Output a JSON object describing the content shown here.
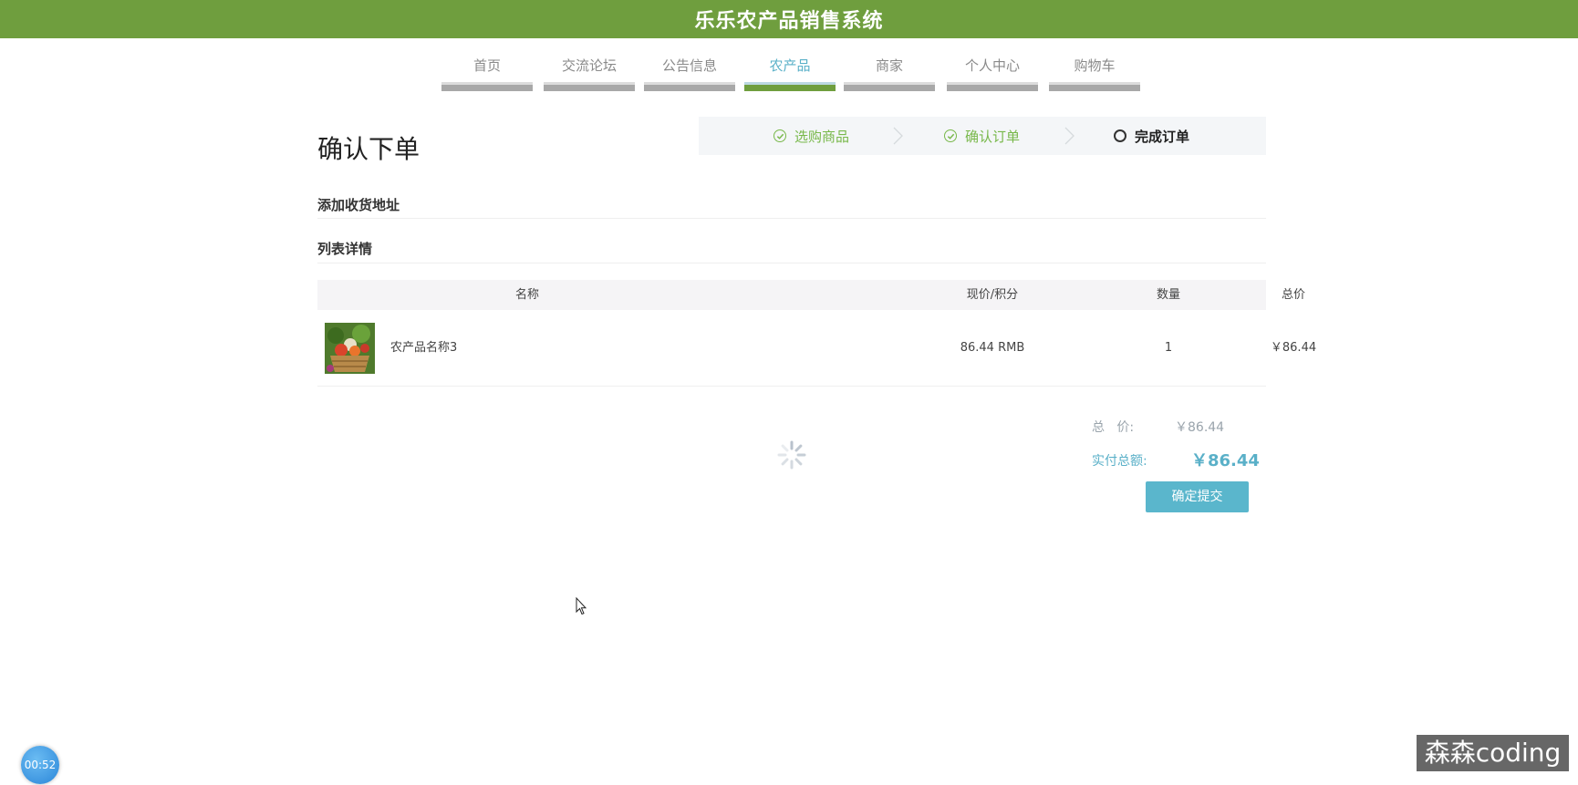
{
  "app": {
    "title": "乐乐农产品销售系统"
  },
  "nav": {
    "items": [
      {
        "label": "首页"
      },
      {
        "label": "交流论坛"
      },
      {
        "label": "公告信息"
      },
      {
        "label": "农产品"
      },
      {
        "label": "商家"
      },
      {
        "label": "个人中心"
      },
      {
        "label": "购物车"
      }
    ],
    "active_index": 3
  },
  "page": {
    "title": "确认下单"
  },
  "steps": [
    {
      "label": "选购商品",
      "state": "done"
    },
    {
      "label": "确认订单",
      "state": "done"
    },
    {
      "label": "完成订单",
      "state": "todo"
    }
  ],
  "sections": {
    "address": "添加收货地址",
    "list": "列表详情"
  },
  "table": {
    "headers": [
      "名称",
      "现价/积分",
      "数量",
      "总价"
    ],
    "rows": [
      {
        "name": "农产品名称3",
        "price": "86.44 RMB",
        "qty": "1",
        "total": "￥86.44"
      }
    ]
  },
  "summary": {
    "total_label": "总   价:",
    "total_value": "￥86.44",
    "pay_label": "实付总额:",
    "pay_value": "￥86.44",
    "submit_label": "确定提交"
  },
  "overlay": {
    "timer": "00:52",
    "watermark": "森森coding"
  },
  "colors": {
    "brand_green": "#6f9e3e",
    "accent_blue": "#5ab0c8",
    "step_green": "#78b84a"
  }
}
